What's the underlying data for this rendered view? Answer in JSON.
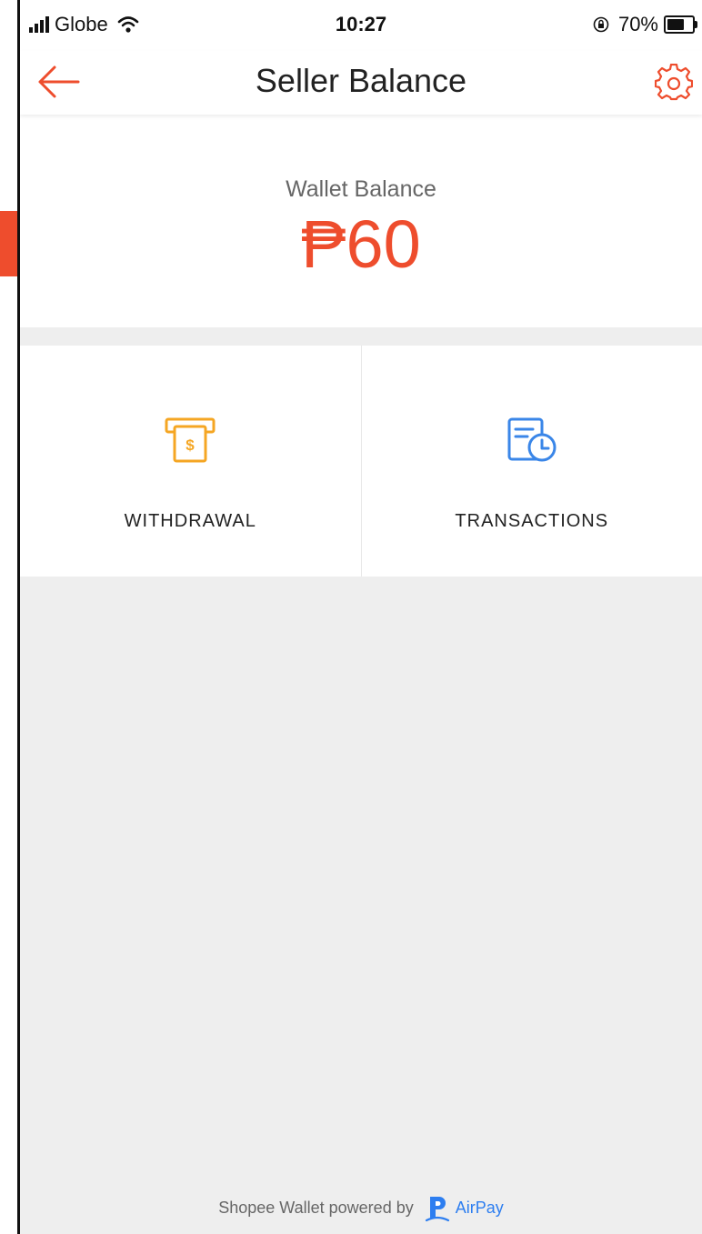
{
  "status_bar": {
    "carrier": "Globe",
    "time": "10:27",
    "battery": "70%",
    "battery_level": 0.7
  },
  "nav": {
    "title": "Seller Balance"
  },
  "balance": {
    "label": "Wallet Balance",
    "amount": "₱60"
  },
  "actions": [
    {
      "label": "WITHDRAWAL",
      "icon": "atm-withdrawal-icon",
      "color": "#f5a623"
    },
    {
      "label": "TRANSACTIONS",
      "icon": "transactions-history-icon",
      "color": "#3a86e8"
    }
  ],
  "footer": {
    "text": "Shopee Wallet powered by",
    "brand": "AirPay"
  },
  "colors": {
    "accent": "#ee4d2d",
    "background": "#eeeeee",
    "airpay_blue": "#2d7ef0"
  }
}
